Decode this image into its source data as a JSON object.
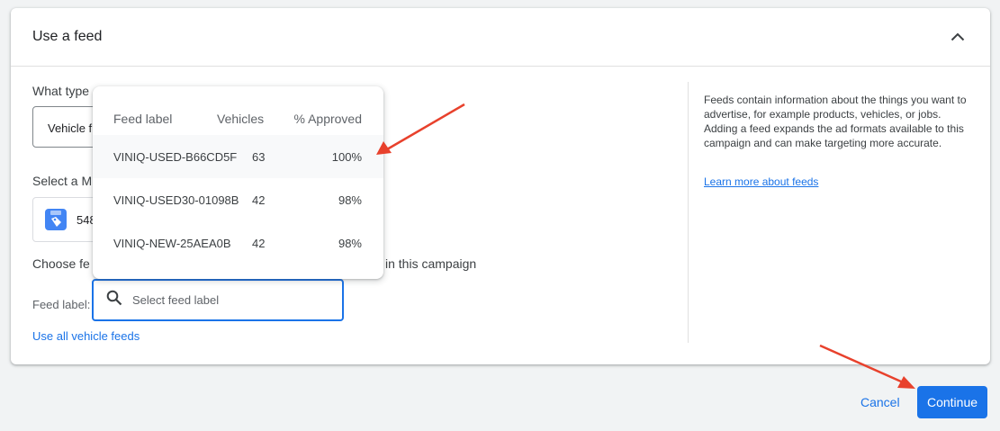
{
  "section": {
    "title": "Use a feed",
    "collapse_icon": "chevron-up-icon"
  },
  "form": {
    "feed_type_question_partial": "What type",
    "feed_type_question_tail": "?",
    "feed_type_value_partial": "Vehicle f",
    "merchant_question_partial": "Select a M",
    "merchant_icon": "merchant-tag-icon",
    "merchant_id_partial": "548",
    "choose_feeds_partial_left": "Choose fe",
    "choose_feeds_partial_right": "in this campaign",
    "feed_label_caption": "Feed label:",
    "feed_label_placeholder": "Select feed label",
    "search_icon": "search-icon",
    "use_all_link": "Use all vehicle feeds"
  },
  "dropdown": {
    "headers": {
      "label": "Feed label",
      "vehicles": "Vehicles",
      "approved": "% Approved"
    },
    "rows": [
      {
        "label": "VINIQ-USED-B66CD5F",
        "vehicles": "63",
        "approved": "100%"
      },
      {
        "label": "VINIQ-USED30-01098B",
        "vehicles": "42",
        "approved": "98%"
      },
      {
        "label": "VINIQ-NEW-25AEA0B",
        "vehicles": "42",
        "approved": "98%"
      }
    ]
  },
  "help": {
    "text": "Feeds contain information about the things you want to advertise, for example products, vehicles, or jobs. Adding a feed expands the ad formats available to this campaign and can make targeting more accurate.",
    "link": "Learn more about feeds"
  },
  "footer": {
    "cancel_label": "Cancel",
    "continue_label": "Continue"
  },
  "colors": {
    "accent": "#1a73e8",
    "annotation_arrow": "#e8412c",
    "page_background": "#f1f3f4"
  }
}
